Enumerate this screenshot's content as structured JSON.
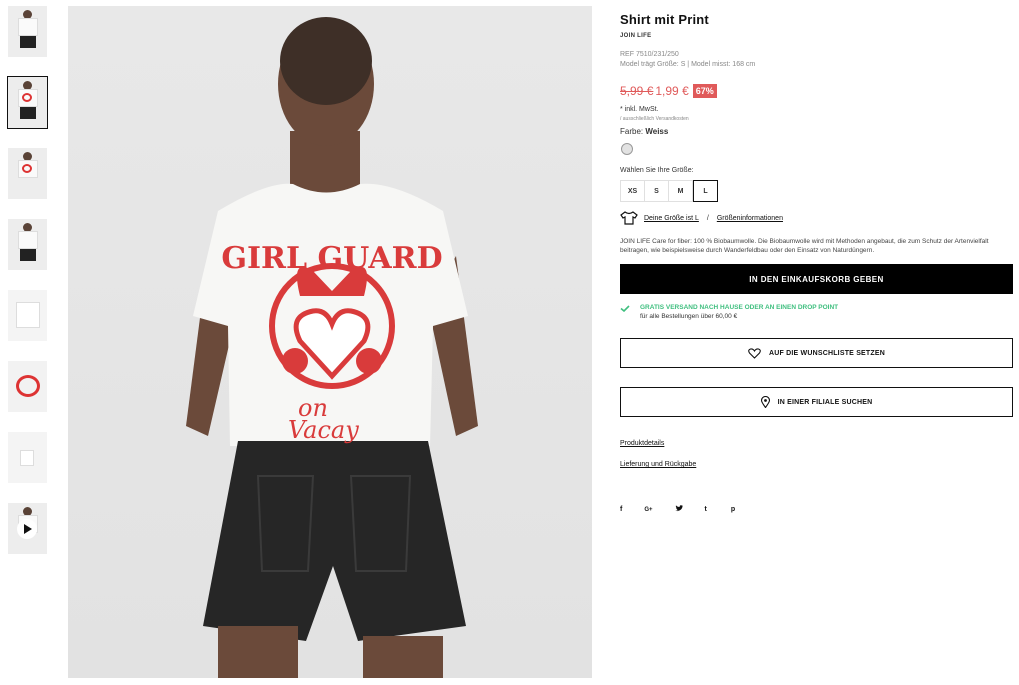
{
  "thumbnails": [
    {
      "label": "front-pose"
    },
    {
      "label": "back-view"
    },
    {
      "label": "print-detail"
    },
    {
      "label": "full-body"
    },
    {
      "label": "flat-front"
    },
    {
      "label": "print-closeup"
    },
    {
      "label": "label-detail"
    },
    {
      "label": "video"
    }
  ],
  "main_image": {
    "print_top": "GIRL GUARD",
    "print_bottom_1": "on",
    "print_bottom_2": "Vacay"
  },
  "product": {
    "title": "Shirt mit Print",
    "brand": "JOIN LIFE",
    "ref": "REF 7510/231/250",
    "model": "Model trägt Größe: S | Model misst: 168 cm",
    "old_price": "5,99 €",
    "new_price": "1,99 €",
    "discount": "67%",
    "tax": "* inkl. MwSt.",
    "shipping_note": "/ ausschließlich Versandkosten",
    "color_label": "Farbe: ",
    "color_value": "Weiss",
    "size_label": "Wählen Sie Ihre Größe:",
    "sizes": [
      "XS",
      "S",
      "M",
      "L"
    ],
    "selected_size": "L",
    "size_link": "Deine Größe ist L",
    "size_sep": "/",
    "size_info_link": "Größeninformationen",
    "description": "JOIN LIFE Care for fiber: 100 % Biobaumwolle. Die Biobaumwolle wird mit Methoden angebaut, die zum Schutz der Artenvielfalt beitragen, wie beispielsweise durch Wanderfeldbau oder den Einsatz von Naturdüngern.",
    "cart_button": "IN DEN EINKAUFSKORB GEBEN",
    "free_shipping_title": "GRATIS VERSAND NACH HAUSE ODER AN EINEN DROP POINT",
    "free_shipping_sub": "für alle Bestellungen über 60,00 €",
    "wishlist_button": "AUF DIE WUNSCHLISTE SETZEN",
    "store_button": "IN EINER FILIALE SUCHEN",
    "details_link": "Produktdetails",
    "delivery_link": "Lieferung und Rückgabe"
  },
  "social": [
    {
      "icon": "facebook-icon",
      "glyph": "f"
    },
    {
      "icon": "google-plus-icon",
      "glyph": "G+"
    },
    {
      "icon": "twitter-icon",
      "glyph": "🐦"
    },
    {
      "icon": "tumblr-icon",
      "glyph": "t"
    },
    {
      "icon": "pinterest-icon",
      "glyph": "p"
    }
  ],
  "colors": {
    "sale_red": "#e05a5a",
    "success_green": "#3fbf7f",
    "print_red": "#d93b3b"
  }
}
